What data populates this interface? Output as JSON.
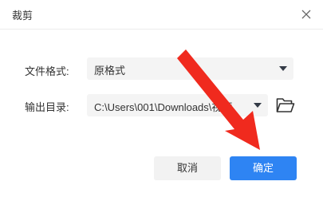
{
  "dialog": {
    "title": "裁剪",
    "close_icon": "close-icon"
  },
  "format": {
    "label": "文件格式:",
    "value": "原格式"
  },
  "output": {
    "label": "输出目录:",
    "value": "C:\\Users\\001\\Downloads\\视频"
  },
  "buttons": {
    "cancel": "取消",
    "confirm": "确定"
  },
  "colors": {
    "primary": "#2e84f3",
    "annotation_arrow": "#f02a1e"
  }
}
